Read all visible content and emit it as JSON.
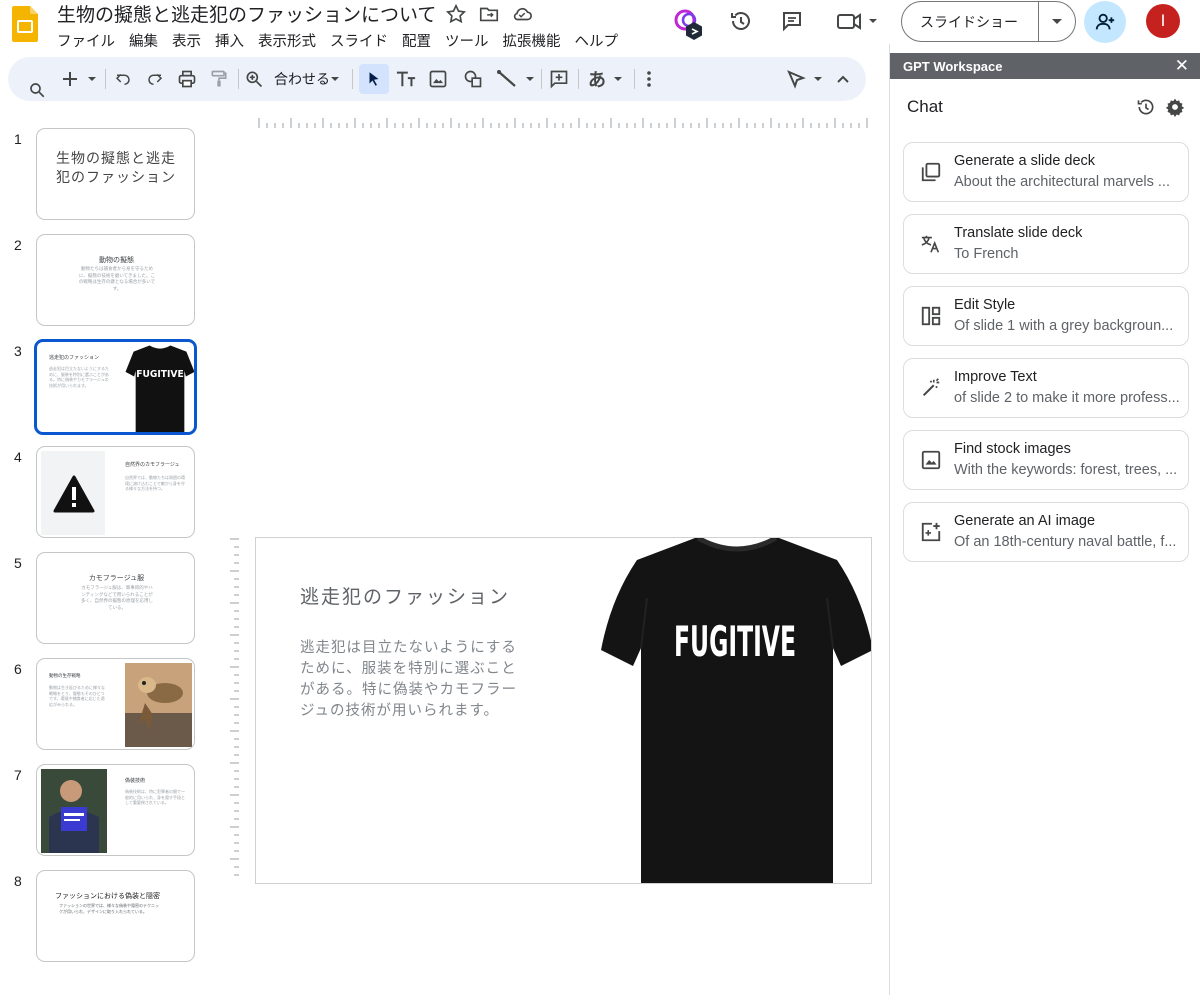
{
  "header": {
    "doc_title": "生物の擬態と逃走犯のファッションについて",
    "menu": [
      "ファイル",
      "編集",
      "表示",
      "挿入",
      "表示形式",
      "スライド",
      "配置",
      "ツール",
      "拡張機能",
      "ヘルプ"
    ],
    "slideshow_label": "スライドショー",
    "avatar_letter": "I"
  },
  "toolbar": {
    "zoom_label": "合わせる"
  },
  "filmstrip": {
    "slides": [
      {
        "num": "1",
        "title": "生物の擬態と逃走犯のファッション",
        "body": ""
      },
      {
        "num": "2",
        "title": "動物の擬態",
        "body": "動物たちは捕食者から身を守るために、擬態の技術を磨いてきました。この戦略は生存の鍵となる場合が多いです。"
      },
      {
        "num": "3",
        "title": "逃走犯のファッション",
        "body": "逃走犯は目立たないようにするために、服装を特別に選ぶことがある。特に偽装やカモフラージュの技術が用いられます。",
        "shirt_text": "FUGITIVE"
      },
      {
        "num": "4",
        "title": "自然界のカモフラージュ",
        "body": "自然界では、動物たちは周囲の環境に溶け込むことで敵から身を守る様々な方法を持つ。"
      },
      {
        "num": "5",
        "title": "カモフラージュ服",
        "body": "カモフラージュ服は、軍事目的やハンティングなどで用いられることが多く、自然界の擬態の原理を応用している。"
      },
      {
        "num": "6",
        "title": "動物の生存戦略",
        "body": "動物は生き延びるために様々な戦略をとり、擬態もそのひとつです。環境や捕食者に応じた適応がみられる。"
      },
      {
        "num": "7",
        "title": "偽装技術",
        "body": "偽装技術は、特に犯罪者の間で一般的に用いられ、身を隠す手段として重要視されている。"
      },
      {
        "num": "8",
        "title": "ファッションにおける偽装と隠密",
        "body": "ファッションの世界では、様々な偽装や隠密のテクニックが用いられ、デザインに取り入れられている。"
      }
    ]
  },
  "slide": {
    "title": "逃走犯のファッション",
    "body": "逃走犯は目立たないようにするために、服装を特別に選ぶことがある。特に偽装やカモフラージュの技術が用いられます。",
    "shirt_text": "FUGITIVE"
  },
  "panel": {
    "header": "GPT Workspace",
    "chat_label": "Chat",
    "cards": [
      {
        "title": "Generate a slide deck",
        "subtitle": "About the architectural marvels ...",
        "icon": "copy-icon"
      },
      {
        "title": "Translate slide deck",
        "subtitle": "To French",
        "icon": "translate-icon"
      },
      {
        "title": "Edit Style",
        "subtitle": "Of slide 1 with a grey backgroun...",
        "icon": "layout-icon"
      },
      {
        "title": "Improve Text",
        "subtitle": "of slide 2 to make it more profess...",
        "icon": "magic-wand-icon"
      },
      {
        "title": "Find stock images",
        "subtitle": "With the keywords: forest, trees, ...",
        "icon": "image-icon"
      },
      {
        "title": "Generate an AI image",
        "subtitle": "Of an 18th-century naval battle, f...",
        "icon": "add-image-icon"
      }
    ]
  },
  "colors": {
    "accent": "#0b57d0",
    "toolbar_bg": "#edf2fa",
    "share_bg": "#c2e7ff",
    "avatar_bg": "#c5221f",
    "panel_header_bg": "#5f6368"
  }
}
